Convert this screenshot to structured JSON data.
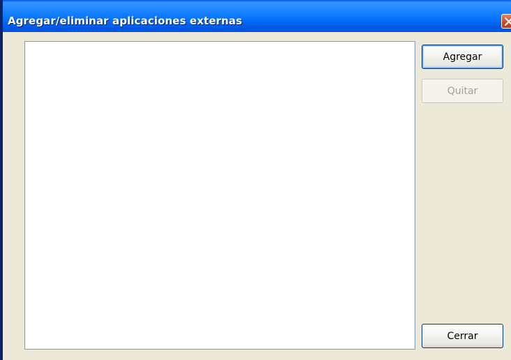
{
  "window": {
    "title": "Agregar/eliminar aplicaciones externas"
  },
  "list": {
    "items": []
  },
  "buttons": {
    "add_label": "Agregar",
    "remove_label": "Quitar",
    "close_label": "Cerrar"
  },
  "icons": {
    "close": "close-icon"
  },
  "colors": {
    "titlebar": "#0054e3",
    "dialog_bg": "#ece9d8",
    "close_button": "#d4441c"
  }
}
